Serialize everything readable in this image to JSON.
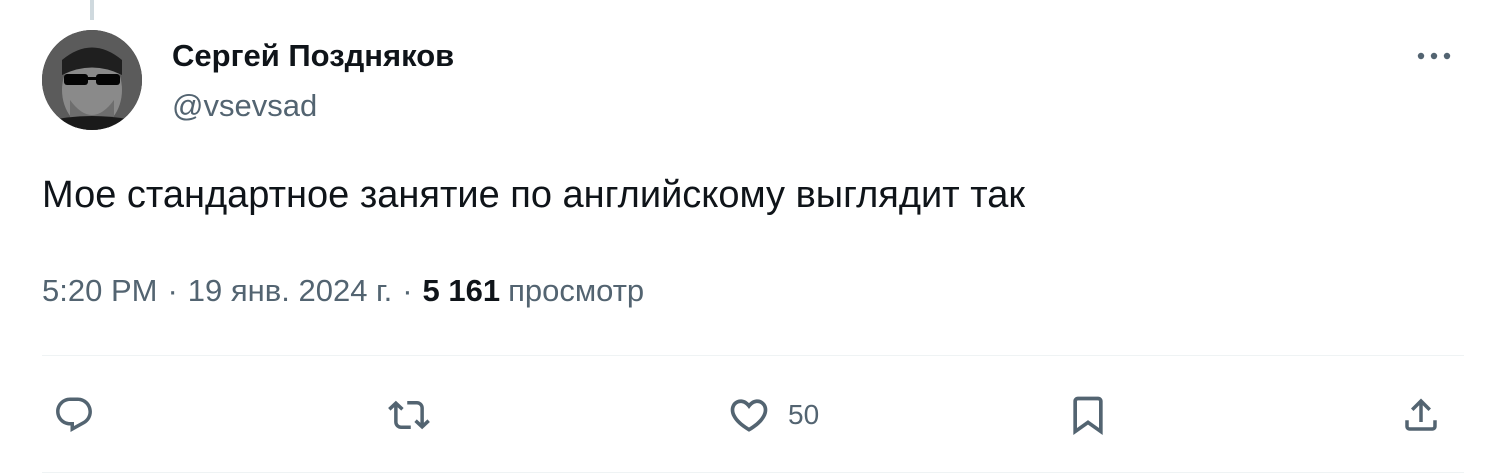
{
  "author": {
    "name": "Сергей Поздняков",
    "handle": "@vsevsad"
  },
  "tweet": {
    "text": "Мое стандартное занятие по английскому выглядит так"
  },
  "meta": {
    "time": "5:20 PM",
    "separator": "·",
    "date": "19 янв. 2024 г.",
    "views_count": "5 161",
    "views_label": "просмотр"
  },
  "actions": {
    "reply": {
      "icon": "reply-icon",
      "count": ""
    },
    "repost": {
      "icon": "repost-icon",
      "count": ""
    },
    "like": {
      "icon": "heart-icon",
      "count": "50"
    },
    "bookmark": {
      "icon": "bookmark-icon",
      "count": ""
    },
    "share": {
      "icon": "share-icon",
      "count": ""
    }
  },
  "icons": {
    "more": "more-horizontal-icon",
    "avatar": "avatar-image"
  },
  "colors": {
    "text_primary": "#0f1419",
    "text_secondary": "#536471",
    "divider": "#eff3f4",
    "thread_line": "#cfd9de"
  }
}
